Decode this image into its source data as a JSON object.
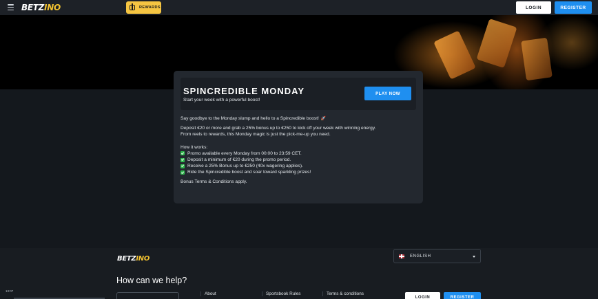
{
  "header": {
    "logo": {
      "text_main": "BETZ",
      "text_accent": "INO"
    },
    "rewards_label": "REWARDS",
    "login_label": "LOGIN",
    "register_label": "REGISTER"
  },
  "promo": {
    "title": "SPINCREDIBLE MONDAY",
    "subtitle": "Start your week with a powerful boost!",
    "play_label": "PLAY NOW",
    "intro": "Say goodbye to the Monday slump and hello to a Spincredible boost!",
    "intro_icon": "rocket-icon",
    "desc_line1": "Deposit €20 or more and grab a 25% bonus up to €250 to kick off your week with winning energy.",
    "desc_line2": "From reels to rewards, this Monday magic is just the pick-me-up you need.",
    "how_title": "How it works:",
    "steps": [
      "Promo available every Monday from 00:00 to 23:59 CET.",
      "Deposit a minimum of €20 during the promo period.",
      "Receive a 25% Bonus up to €250 (40x wagering applies).",
      "Ride the Spincredible boost and soar toward sparkling prizes!"
    ],
    "terms": "Bonus Terms & Conditions apply."
  },
  "footer": {
    "logo": {
      "text_main": "BETZ",
      "text_accent": "INO"
    },
    "language": "ENGLISH",
    "help_title": "How can we help?",
    "clock": "13:07",
    "links": [
      "About",
      "Sportsbook Rules",
      "Terms & conditions"
    ],
    "login_label": "LOGIN",
    "register_label": "REGISTER"
  },
  "colors": {
    "accent_blue": "#1f8ff0",
    "rewards_yellow": "#f5c542",
    "check_green": "#2eb84c"
  }
}
